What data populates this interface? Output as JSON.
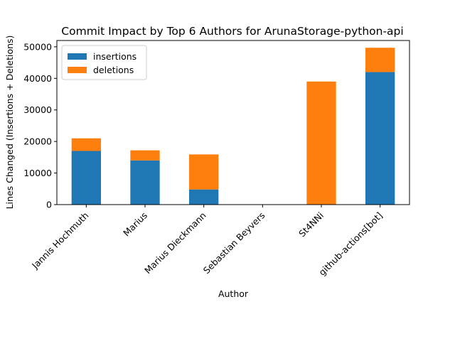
{
  "chart_data": {
    "type": "bar",
    "stacked": true,
    "title": "Commit Impact by Top 6 Authors for ArunaStorage-python-api",
    "xlabel": "Author",
    "ylabel": "Lines Changed (Insertions + Deletions)",
    "categories": [
      "Jannis Hochmuth",
      "Marius",
      "Marius Dieckmann",
      "Sebastian Beyvers",
      "St4NNi",
      "github-actions[bot]"
    ],
    "series": [
      {
        "name": "insertions",
        "color": "#1f77b4",
        "values": [
          17000,
          14000,
          4800,
          0,
          0,
          42000
        ]
      },
      {
        "name": "deletions",
        "color": "#ff7f0e",
        "values": [
          4000,
          3200,
          11100,
          0,
          39000,
          7700
        ]
      }
    ],
    "ylim": [
      0,
      52000
    ],
    "yticks": [
      0,
      10000,
      20000,
      30000,
      40000,
      50000
    ],
    "grid": false,
    "legend": "upper-left"
  }
}
